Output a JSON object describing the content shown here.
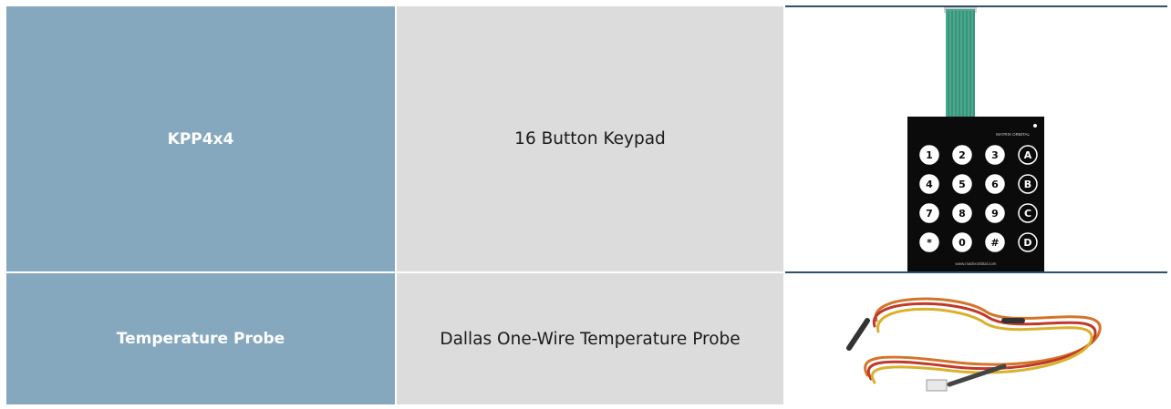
{
  "rows": [
    {
      "name": "KPP4x4",
      "description": "16 Button Keypad",
      "image": {
        "icon": "keypad-icon",
        "brand": "MATRIX ORBITAL",
        "keys": [
          "1",
          "2",
          "3",
          "A",
          "4",
          "5",
          "6",
          "B",
          "7",
          "8",
          "9",
          "C",
          "*",
          "0",
          "#",
          "D"
        ],
        "url_text": "www.matrixorbital.com"
      }
    },
    {
      "name": "Temperature Probe",
      "description": "Dallas One-Wire Temperature Probe",
      "image": {
        "icon": "temperature-probe-cable-icon"
      }
    }
  ],
  "colors": {
    "name_bg": "#86a8bf",
    "desc_bg": "#dcdcdc",
    "rule": "#2f4f6a"
  }
}
